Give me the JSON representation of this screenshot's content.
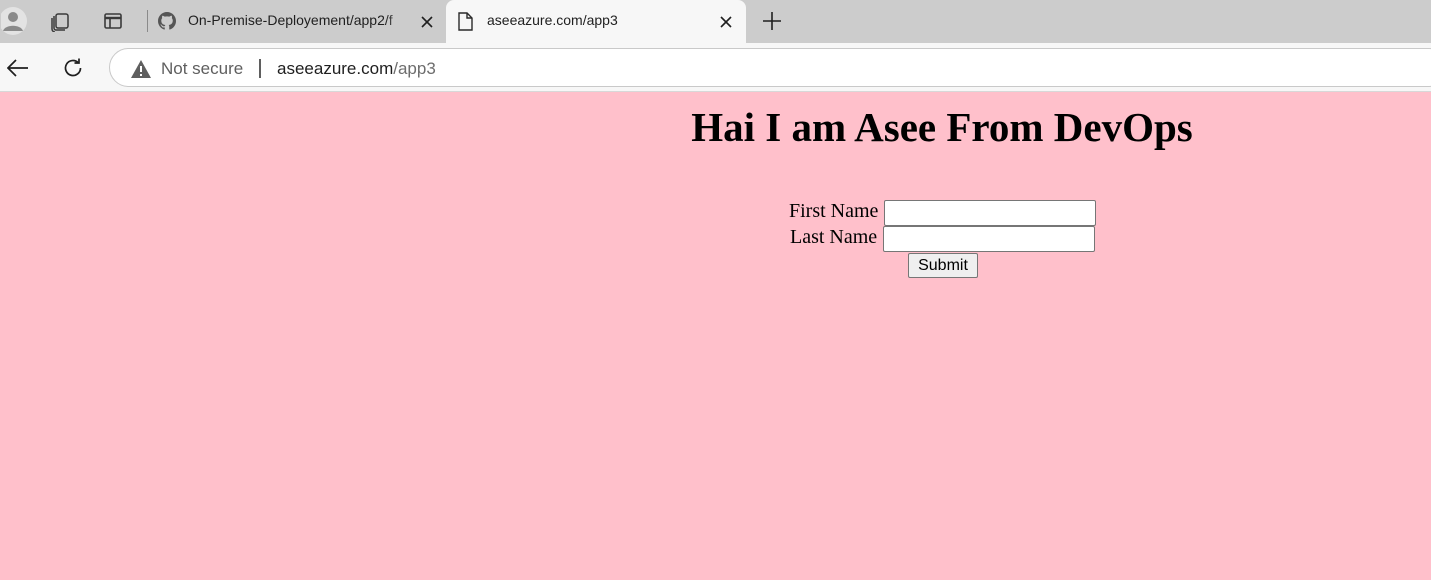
{
  "browser": {
    "tabs": [
      {
        "title": "On-Premise-Deployement/app2/f",
        "icon": "github-icon",
        "active": false
      },
      {
        "title": "aseeazure.com/app3",
        "icon": "page-icon",
        "active": true
      }
    ],
    "address_bar": {
      "security_label": "Not secure",
      "url_host": "aseeazure.com",
      "url_path": "/app3"
    }
  },
  "page": {
    "background_color": "#ffc0cb",
    "heading": "Hai I am Asee From DevOps",
    "form": {
      "first_name_label": "First Name",
      "first_name_value": "",
      "last_name_label": "Last Name",
      "last_name_value": "",
      "submit_label": "Submit"
    }
  }
}
